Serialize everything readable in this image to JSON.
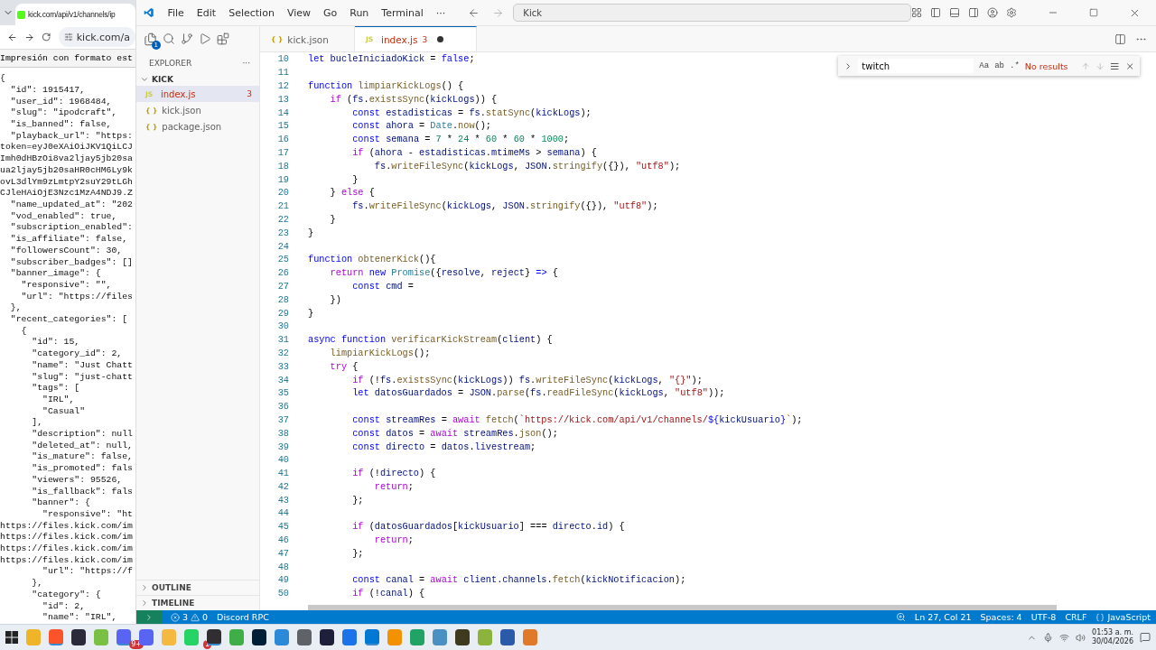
{
  "browser": {
    "tab_title": "kick.com/api/v1/channels/ip",
    "address": "kick.com/a",
    "pretty_print_label": "Impresión con formato est",
    "json_lines": [
      "{",
      "  \"id\": 1915417,",
      "  \"user_id\": 1968484,",
      "  \"slug\": \"ipodcraft\",",
      "  \"is_banned\": false,",
      "  \"playback_url\": \"https:",
      "token=eyJ0eXAiOiJKV1QiLCJ",
      "Imh0dHBzOi8va2ljay5jb20sa",
      "ua2ljay5jb20saHR0cHM6Ly9k",
      "ovL3dlYm9zLmtpY2suY29tLGh",
      "CJleHAiOjE3Nzc1MzA4NDJ9.Z",
      "  \"name_updated_at\": \"202",
      "  \"vod_enabled\": true,",
      "  \"subscription_enabled\":",
      "  \"is_affiliate\": false,",
      "  \"followersCount\": 30,",
      "  \"subscriber_badges\": []",
      "  \"banner_image\": {",
      "    \"responsive\": \"\",",
      "    \"url\": \"https://files",
      "  },",
      "  \"recent_categories\": [",
      "    {",
      "      \"id\": 15,",
      "      \"category_id\": 2,",
      "      \"name\": \"Just Chatt",
      "      \"slug\": \"just-chatt",
      "      \"tags\": [",
      "        \"IRL\",",
      "        \"Casual\"",
      "      ],",
      "      \"description\": null",
      "      \"deleted_at\": null,",
      "      \"is_mature\": false,",
      "      \"is_promoted\": fals",
      "      \"viewers\": 95526,",
      "      \"is_fallback\": fals",
      "      \"banner\": {",
      "        \"responsive\": \"ht",
      "https://files.kick.com/im",
      "https://files.kick.com/im",
      "https://files.kick.com/im",
      "https://files.kick.com/im",
      "        \"url\": \"https://f",
      "      },",
      "      \"category\": {",
      "        \"id\": 2,",
      "        \"name\": \"IRL\","
    ]
  },
  "window": {
    "menu": [
      "File",
      "Edit",
      "Selection",
      "View",
      "Go",
      "Run",
      "Terminal",
      "···"
    ],
    "command_center": "Kick"
  },
  "activity_bar": {
    "explorer_badge": "1"
  },
  "sidebar": {
    "title": "EXPLORER",
    "more": "···",
    "folder": {
      "name": "KICK",
      "expanded": true
    },
    "files": [
      {
        "name": "index.js",
        "kind": "js",
        "icon": "JS",
        "selected": true,
        "badge": "3"
      },
      {
        "name": "kick.json",
        "kind": "json",
        "icon": "{ }",
        "selected": false
      },
      {
        "name": "package.json",
        "kind": "json",
        "icon": "{ }",
        "selected": false
      }
    ],
    "sections": [
      {
        "name": "OUTLINE",
        "expanded": false
      },
      {
        "name": "TIMELINE",
        "expanded": false
      }
    ]
  },
  "tabs": [
    {
      "label": "kick.json",
      "kind": "json",
      "icon": "{ }",
      "selected": false
    },
    {
      "label": "index.js",
      "kind": "js",
      "icon": "JS",
      "selected": true,
      "badge": "3",
      "dirty": true
    }
  ],
  "find": {
    "value": "twitch",
    "options": [
      "Aa",
      "ab",
      ".*"
    ],
    "result": "No results"
  },
  "code_lines": [
    {
      "number": "10",
      "tokens": [
        {
          "kind": "kw",
          "text": "let "
        },
        {
          "kind": "var",
          "text": "bucleIniciadoKick"
        },
        {
          "kind": "p",
          "text": " = "
        },
        {
          "kind": "kw",
          "text": "false"
        },
        {
          "kind": "p",
          "text": ";"
        }
      ]
    },
    {
      "number": "11"
    },
    {
      "number": "12",
      "tokens": [
        {
          "kind": "kw",
          "text": "function "
        },
        {
          "kind": "fn",
          "text": "limpiarKickLogs"
        },
        {
          "kind": "p",
          "text": "() {"
        }
      ]
    },
    {
      "number": "13",
      "tokens": [
        {
          "kind": "ctl",
          "text": "    if"
        },
        {
          "kind": "p",
          "text": " ("
        },
        {
          "kind": "var",
          "text": "fs"
        },
        {
          "kind": "p",
          "text": "."
        },
        {
          "kind": "fn",
          "text": "existsSync"
        },
        {
          "kind": "p",
          "text": "("
        },
        {
          "kind": "var",
          "text": "kickLogs"
        },
        {
          "kind": "p",
          "text": ")) {"
        }
      ]
    },
    {
      "number": "14",
      "tokens": [
        {
          "kind": "kw",
          "text": "        const "
        },
        {
          "kind": "var",
          "text": "estadisticas"
        },
        {
          "kind": "p",
          "text": " = "
        },
        {
          "kind": "var",
          "text": "fs"
        },
        {
          "kind": "p",
          "text": "."
        },
        {
          "kind": "fn",
          "text": "statSync"
        },
        {
          "kind": "p",
          "text": "("
        },
        {
          "kind": "var",
          "text": "kickLogs"
        },
        {
          "kind": "p",
          "text": ");"
        }
      ]
    },
    {
      "number": "15",
      "tokens": [
        {
          "kind": "kw",
          "text": "        const "
        },
        {
          "kind": "var",
          "text": "ahora"
        },
        {
          "kind": "p",
          "text": " = "
        },
        {
          "kind": "type",
          "text": "Date"
        },
        {
          "kind": "p",
          "text": "."
        },
        {
          "kind": "fn",
          "text": "now"
        },
        {
          "kind": "p",
          "text": "();"
        }
      ]
    },
    {
      "number": "16",
      "tokens": [
        {
          "kind": "kw",
          "text": "        const "
        },
        {
          "kind": "var",
          "text": "semana"
        },
        {
          "kind": "p",
          "text": " = "
        },
        {
          "kind": "num",
          "text": "7"
        },
        {
          "kind": "p",
          "text": " * "
        },
        {
          "kind": "num",
          "text": "24"
        },
        {
          "kind": "p",
          "text": " * "
        },
        {
          "kind": "num",
          "text": "60"
        },
        {
          "kind": "p",
          "text": " * "
        },
        {
          "kind": "num",
          "text": "60"
        },
        {
          "kind": "p",
          "text": " * "
        },
        {
          "kind": "num",
          "text": "1000"
        },
        {
          "kind": "p",
          "text": ";"
        }
      ]
    },
    {
      "number": "17",
      "tokens": [
        {
          "kind": "ctl",
          "text": "        if"
        },
        {
          "kind": "p",
          "text": " ("
        },
        {
          "kind": "var",
          "text": "ahora"
        },
        {
          "kind": "p",
          "text": " - "
        },
        {
          "kind": "var",
          "text": "estadisticas"
        },
        {
          "kind": "p",
          "text": "."
        },
        {
          "kind": "var",
          "text": "mtimeMs"
        },
        {
          "kind": "p",
          "text": " > "
        },
        {
          "kind": "var",
          "text": "semana"
        },
        {
          "kind": "p",
          "text": ") {"
        }
      ]
    },
    {
      "number": "18",
      "tokens": [
        {
          "kind": "var",
          "text": "            fs"
        },
        {
          "kind": "p",
          "text": "."
        },
        {
          "kind": "fn",
          "text": "writeFileSync"
        },
        {
          "kind": "p",
          "text": "("
        },
        {
          "kind": "var",
          "text": "kickLogs"
        },
        {
          "kind": "p",
          "text": ", "
        },
        {
          "kind": "var",
          "text": "JSON"
        },
        {
          "kind": "p",
          "text": "."
        },
        {
          "kind": "fn",
          "text": "stringify"
        },
        {
          "kind": "p",
          "text": "({}), "
        },
        {
          "kind": "str",
          "text": "\"utf8\""
        },
        {
          "kind": "p",
          "text": ");"
        }
      ]
    },
    {
      "number": "19",
      "tokens": [
        {
          "kind": "p",
          "text": "        }"
        }
      ]
    },
    {
      "number": "20",
      "tokens": [
        {
          "kind": "p",
          "text": "    } "
        },
        {
          "kind": "ctl",
          "text": "else"
        },
        {
          "kind": "p",
          "text": " {"
        }
      ]
    },
    {
      "number": "21",
      "tokens": [
        {
          "kind": "var",
          "text": "        fs"
        },
        {
          "kind": "p",
          "text": "."
        },
        {
          "kind": "fn",
          "text": "writeFileSync"
        },
        {
          "kind": "p",
          "text": "("
        },
        {
          "kind": "var",
          "text": "kickLogs"
        },
        {
          "kind": "p",
          "text": ", "
        },
        {
          "kind": "var",
          "text": "JSON"
        },
        {
          "kind": "p",
          "text": "."
        },
        {
          "kind": "fn",
          "text": "stringify"
        },
        {
          "kind": "p",
          "text": "({}), "
        },
        {
          "kind": "str",
          "text": "\"utf8\""
        },
        {
          "kind": "p",
          "text": ");"
        }
      ]
    },
    {
      "number": "22",
      "tokens": [
        {
          "kind": "p",
          "text": "    }"
        }
      ]
    },
    {
      "number": "23",
      "tokens": [
        {
          "kind": "p",
          "text": "}"
        }
      ]
    },
    {
      "number": "24"
    },
    {
      "number": "25",
      "tokens": [
        {
          "kind": "kw",
          "text": "function "
        },
        {
          "kind": "fn",
          "text": "obtenerKick"
        },
        {
          "kind": "p",
          "text": "(){"
        }
      ]
    },
    {
      "number": "26",
      "tokens": [
        {
          "kind": "ctl",
          "text": "    return "
        },
        {
          "kind": "kw",
          "text": "new "
        },
        {
          "kind": "type",
          "text": "Promise"
        },
        {
          "kind": "p",
          "text": "({"
        },
        {
          "kind": "var",
          "text": "resolve"
        },
        {
          "kind": "p",
          "text": ", "
        },
        {
          "kind": "var",
          "text": "reject"
        },
        {
          "kind": "p",
          "text": "} "
        },
        {
          "kind": "kw",
          "text": "=>"
        },
        {
          "kind": "p",
          "text": " {"
        }
      ]
    },
    {
      "number": "27",
      "tokens": [
        {
          "kind": "kw",
          "text": "        const "
        },
        {
          "kind": "var",
          "text": "cmd"
        },
        {
          "kind": "p",
          "text": " = "
        }
      ]
    },
    {
      "number": "28",
      "tokens": [
        {
          "kind": "p",
          "text": "    })"
        }
      ]
    },
    {
      "number": "29",
      "tokens": [
        {
          "kind": "p",
          "text": "}"
        }
      ]
    },
    {
      "number": "30"
    },
    {
      "number": "31",
      "tokens": [
        {
          "kind": "kw",
          "text": "async function "
        },
        {
          "kind": "fn",
          "text": "verificarKickStream"
        },
        {
          "kind": "p",
          "text": "("
        },
        {
          "kind": "var",
          "text": "client"
        },
        {
          "kind": "p",
          "text": ") {"
        }
      ]
    },
    {
      "number": "32",
      "tokens": [
        {
          "kind": "fn",
          "text": "    limpiarKickLogs"
        },
        {
          "kind": "p",
          "text": "();"
        }
      ]
    },
    {
      "number": "33",
      "tokens": [
        {
          "kind": "ctl",
          "text": "    try"
        },
        {
          "kind": "p",
          "text": " {"
        }
      ]
    },
    {
      "number": "34",
      "tokens": [
        {
          "kind": "ctl",
          "text": "        if"
        },
        {
          "kind": "p",
          "text": " (!"
        },
        {
          "kind": "var",
          "text": "fs"
        },
        {
          "kind": "p",
          "text": "."
        },
        {
          "kind": "fn",
          "text": "existsSync"
        },
        {
          "kind": "p",
          "text": "("
        },
        {
          "kind": "var",
          "text": "kickLogs"
        },
        {
          "kind": "p",
          "text": ")) "
        },
        {
          "kind": "var",
          "text": "fs"
        },
        {
          "kind": "p",
          "text": "."
        },
        {
          "kind": "fn",
          "text": "writeFileSync"
        },
        {
          "kind": "p",
          "text": "("
        },
        {
          "kind": "var",
          "text": "kickLogs"
        },
        {
          "kind": "p",
          "text": ", "
        },
        {
          "kind": "str",
          "text": "\"{}\""
        },
        {
          "kind": "p",
          "text": ");"
        }
      ]
    },
    {
      "number": "35",
      "tokens": [
        {
          "kind": "kw",
          "text": "        let "
        },
        {
          "kind": "var",
          "text": "datosGuardados"
        },
        {
          "kind": "p",
          "text": " = "
        },
        {
          "kind": "var",
          "text": "JSON"
        },
        {
          "kind": "p",
          "text": "."
        },
        {
          "kind": "fn",
          "text": "parse"
        },
        {
          "kind": "p",
          "text": "("
        },
        {
          "kind": "var",
          "text": "fs"
        },
        {
          "kind": "p",
          "text": "."
        },
        {
          "kind": "fn",
          "text": "readFileSync"
        },
        {
          "kind": "p",
          "text": "("
        },
        {
          "kind": "var",
          "text": "kickLogs"
        },
        {
          "kind": "p",
          "text": ", "
        },
        {
          "kind": "str",
          "text": "\"utf8\""
        },
        {
          "kind": "p",
          "text": "));"
        }
      ]
    },
    {
      "number": "36"
    },
    {
      "number": "37",
      "tokens": [
        {
          "kind": "kw",
          "text": "        const "
        },
        {
          "kind": "var",
          "text": "streamRes"
        },
        {
          "kind": "p",
          "text": " = "
        },
        {
          "kind": "ctl",
          "text": "await "
        },
        {
          "kind": "fn",
          "text": "fetch"
        },
        {
          "kind": "p",
          "text": "("
        },
        {
          "kind": "str",
          "text": "`https://kick.com/api/v1/channels/"
        },
        {
          "kind": "kw",
          "text": "${"
        },
        {
          "kind": "var",
          "text": "kickUsuario"
        },
        {
          "kind": "kw",
          "text": "}"
        },
        {
          "kind": "str",
          "text": "`"
        },
        {
          "kind": "p",
          "text": ");"
        }
      ]
    },
    {
      "number": "38",
      "tokens": [
        {
          "kind": "kw",
          "text": "        const "
        },
        {
          "kind": "var",
          "text": "datos"
        },
        {
          "kind": "p",
          "text": " = "
        },
        {
          "kind": "ctl",
          "text": "await "
        },
        {
          "kind": "var",
          "text": "streamRes"
        },
        {
          "kind": "p",
          "text": "."
        },
        {
          "kind": "fn",
          "text": "json"
        },
        {
          "kind": "p",
          "text": "();"
        }
      ]
    },
    {
      "number": "39",
      "tokens": [
        {
          "kind": "kw",
          "text": "        const "
        },
        {
          "kind": "var",
          "text": "directo"
        },
        {
          "kind": "p",
          "text": " = "
        },
        {
          "kind": "var",
          "text": "datos"
        },
        {
          "kind": "p",
          "text": "."
        },
        {
          "kind": "var",
          "text": "livestream"
        },
        {
          "kind": "p",
          "text": ";"
        }
      ]
    },
    {
      "number": "40"
    },
    {
      "number": "41",
      "tokens": [
        {
          "kind": "ctl",
          "text": "        if"
        },
        {
          "kind": "p",
          "text": " (!"
        },
        {
          "kind": "var",
          "text": "directo"
        },
        {
          "kind": "p",
          "text": ") {"
        }
      ]
    },
    {
      "number": "42",
      "tokens": [
        {
          "kind": "ctl",
          "text": "            return"
        },
        {
          "kind": "p",
          "text": ";"
        }
      ]
    },
    {
      "number": "43",
      "tokens": [
        {
          "kind": "p",
          "text": "        };"
        }
      ]
    },
    {
      "number": "44"
    },
    {
      "number": "45",
      "tokens": [
        {
          "kind": "ctl",
          "text": "        if"
        },
        {
          "kind": "p",
          "text": " ("
        },
        {
          "kind": "var",
          "text": "datosGuardados"
        },
        {
          "kind": "p",
          "text": "["
        },
        {
          "kind": "var",
          "text": "kickUsuario"
        },
        {
          "kind": "p",
          "text": "] === "
        },
        {
          "kind": "var",
          "text": "directo"
        },
        {
          "kind": "p",
          "text": "."
        },
        {
          "kind": "var",
          "text": "id"
        },
        {
          "kind": "p",
          "text": ") {"
        }
      ]
    },
    {
      "number": "46",
      "tokens": [
        {
          "kind": "ctl",
          "text": "            return"
        },
        {
          "kind": "p",
          "text": ";"
        }
      ]
    },
    {
      "number": "47",
      "tokens": [
        {
          "kind": "p",
          "text": "        };"
        }
      ]
    },
    {
      "number": "48"
    },
    {
      "number": "49",
      "tokens": [
        {
          "kind": "kw",
          "text": "        const "
        },
        {
          "kind": "var",
          "text": "canal"
        },
        {
          "kind": "p",
          "text": " = "
        },
        {
          "kind": "ctl",
          "text": "await "
        },
        {
          "kind": "var",
          "text": "client"
        },
        {
          "kind": "p",
          "text": "."
        },
        {
          "kind": "var",
          "text": "channels"
        },
        {
          "kind": "p",
          "text": "."
        },
        {
          "kind": "fn",
          "text": "fetch"
        },
        {
          "kind": "p",
          "text": "("
        },
        {
          "kind": "var",
          "text": "kickNotificacion"
        },
        {
          "kind": "p",
          "text": ");"
        }
      ]
    },
    {
      "number": "50",
      "tokens": [
        {
          "kind": "ctl",
          "text": "        if"
        },
        {
          "kind": "p",
          "text": " (!"
        },
        {
          "kind": "var",
          "text": "canal"
        },
        {
          "kind": "p",
          "text": ") {"
        }
      ]
    }
  ],
  "status_bar": {
    "errors": "3",
    "warnings": "0",
    "extension": "Discord RPC",
    "position": "Ln 27, Col 21",
    "indent": "Spaces: 4",
    "encoding": "UTF-8",
    "eol": "CRLF",
    "language": "JavaScript"
  },
  "taskbar": {
    "apps": [
      {
        "color": "#f0b429",
        "active": false
      },
      {
        "color": "#fb542b",
        "active": true
      },
      {
        "color": "#2a2a3a",
        "active": false
      },
      {
        "color": "#7ac143",
        "active": false
      },
      {
        "color": "#5865f2",
        "active": true,
        "badge": "9+"
      },
      {
        "color": "#5865f2",
        "active": false
      },
      {
        "color": "#f5b841",
        "active": false
      },
      {
        "color": "#25d366",
        "active": false,
        "badge": "1"
      },
      {
        "color": "#302e31",
        "active": true
      },
      {
        "color": "#3fae49",
        "active": false
      },
      {
        "color": "#001e36",
        "active": false
      },
      {
        "color": "#2b8ad8",
        "active": false
      },
      {
        "color": "#5f6368",
        "active": false
      },
      {
        "color": "#1e1f3a",
        "active": false
      },
      {
        "color": "#1a73e8",
        "active": false
      },
      {
        "color": "#0078d4",
        "active": true
      },
      {
        "color": "#f39200",
        "active": false
      },
      {
        "color": "#21a366",
        "active": false
      },
      {
        "color": "#4a90c2",
        "active": false
      },
      {
        "color": "#3d3a1e",
        "active": false
      },
      {
        "color": "#8cb43c",
        "active": false
      },
      {
        "color": "#2a5aa8",
        "active": false
      },
      {
        "color": "#e07a2a",
        "active": false
      }
    ],
    "time": "01:53 a. m.",
    "date": "30/04/2026"
  }
}
